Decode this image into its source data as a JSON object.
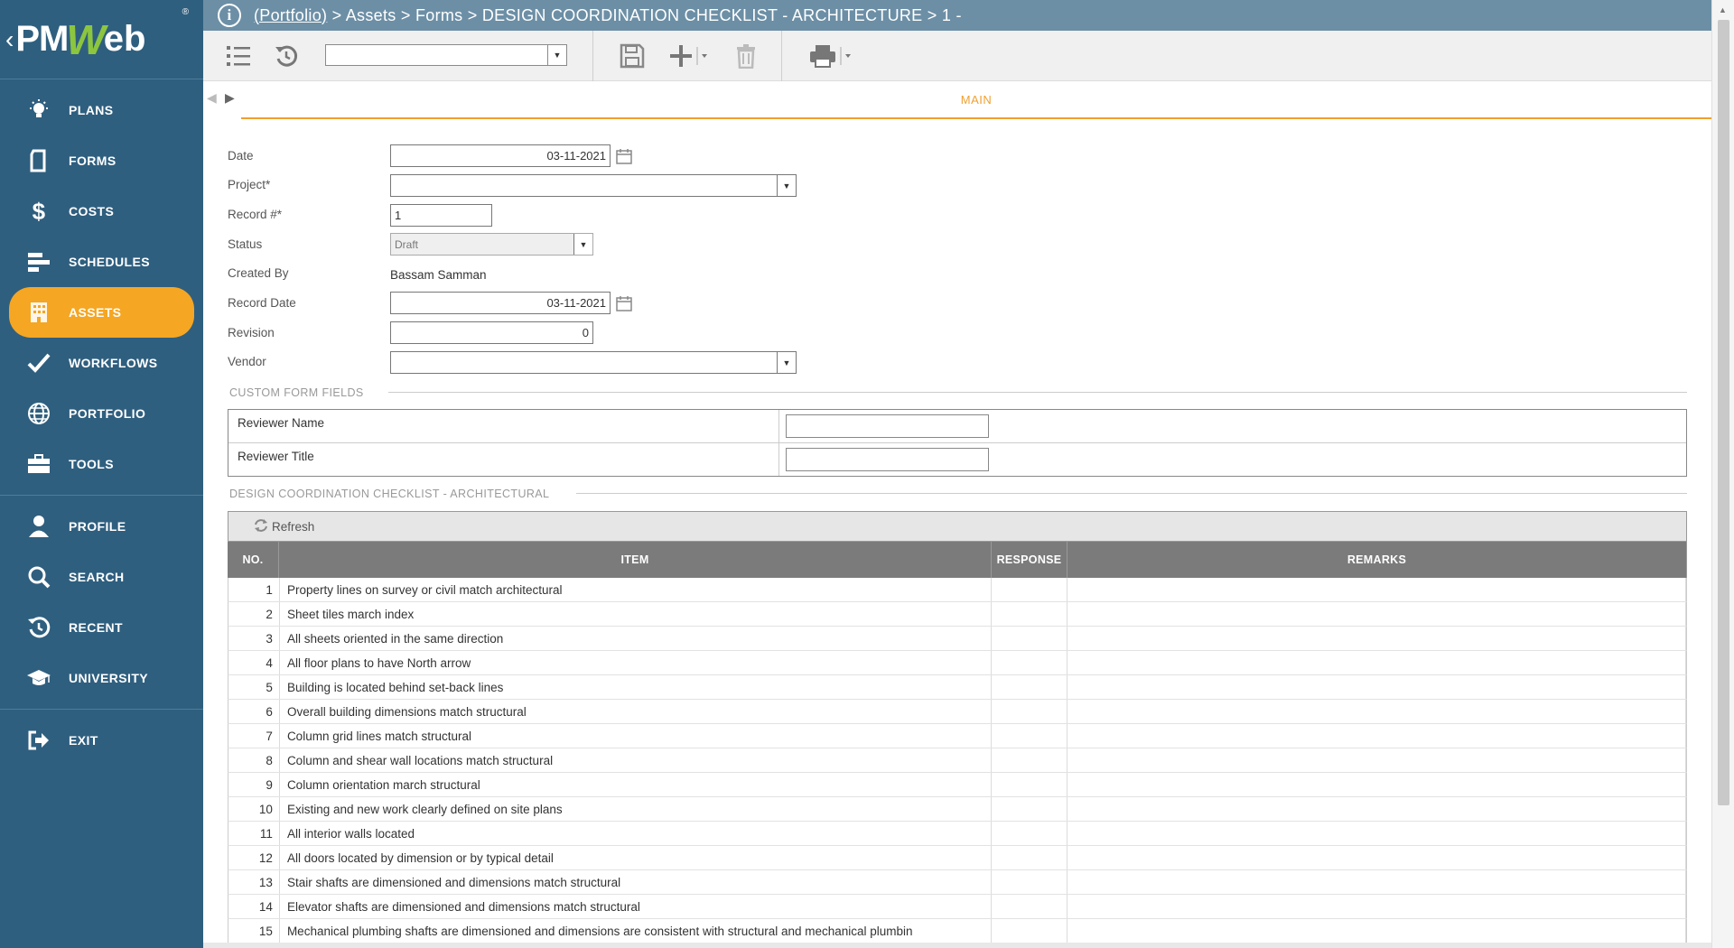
{
  "sidebar": {
    "logo": {
      "chevron": "‹",
      "pm": "PM",
      "w": "W",
      "eb": "eb",
      "reg": "®"
    },
    "groups": [
      [
        {
          "label": "PLANS",
          "icon": "lightbulb-icon"
        },
        {
          "label": "FORMS",
          "icon": "document-icon"
        },
        {
          "label": "COSTS",
          "icon": "dollar-icon"
        },
        {
          "label": "SCHEDULES",
          "icon": "gantt-icon"
        },
        {
          "label": "ASSETS",
          "icon": "building-icon",
          "active": true
        },
        {
          "label": "WORKFLOWS",
          "icon": "checkmark-icon"
        },
        {
          "label": "PORTFOLIO",
          "icon": "globe-icon"
        },
        {
          "label": "TOOLS",
          "icon": "briefcase-icon"
        }
      ],
      [
        {
          "label": "PROFILE",
          "icon": "user-icon"
        },
        {
          "label": "SEARCH",
          "icon": "search-icon"
        },
        {
          "label": "RECENT",
          "icon": "history-icon"
        },
        {
          "label": "UNIVERSITY",
          "icon": "graduation-cap-icon"
        }
      ],
      [
        {
          "label": "EXIT",
          "icon": "exit-icon"
        }
      ]
    ],
    "active_color": "#f5a623",
    "bg_color": "#2f5f7f"
  },
  "breadcrumb": {
    "info": "i",
    "portfolio_link": "(Portfolio)",
    "rest": " > Assets > Forms > DESIGN COORDINATION CHECKLIST - ARCHITECTURE > 1 -"
  },
  "toolbar": {
    "select_value": "",
    "icons": [
      "list-icon",
      "history-icon",
      "save-icon",
      "add-icon",
      "delete-icon",
      "print-icon"
    ]
  },
  "tabs": {
    "main": "MAIN"
  },
  "form": {
    "date_label": "Date",
    "date_value": "03-11-2021",
    "project_label": "Project*",
    "project_value": "",
    "record_no_label": "Record #*",
    "record_no_value": "1",
    "status_label": "Status",
    "status_value": "Draft",
    "created_by_label": "Created By",
    "created_by_value": "Bassam Samman",
    "record_date_label": "Record Date",
    "record_date_value": "03-11-2021",
    "revision_label": "Revision",
    "revision_value": "0",
    "vendor_label": "Vendor",
    "vendor_value": ""
  },
  "custom_fields": {
    "title": "CUSTOM FORM FIELDS",
    "reviewer_name_label": "Reviewer Name",
    "reviewer_name_value": "",
    "reviewer_title_label": "Reviewer Title",
    "reviewer_title_value": ""
  },
  "checklist": {
    "title": "DESIGN COORDINATION CHECKLIST - ARCHITECTURAL",
    "refresh_label": "Refresh",
    "columns": {
      "no": "NO.",
      "item": "ITEM",
      "response": "RESPONSE",
      "remarks": "REMARKS"
    },
    "rows": [
      {
        "no": "1",
        "item": "Property lines on survey or civil match architectural",
        "response": "",
        "remarks": ""
      },
      {
        "no": "2",
        "item": "Sheet tiles march index",
        "response": "",
        "remarks": ""
      },
      {
        "no": "3",
        "item": "All sheets oriented in the same direction",
        "response": "",
        "remarks": ""
      },
      {
        "no": "4",
        "item": "All floor plans to have North arrow",
        "response": "",
        "remarks": ""
      },
      {
        "no": "5",
        "item": "Building is located behind set-back lines",
        "response": "",
        "remarks": ""
      },
      {
        "no": "6",
        "item": "Overall building dimensions match structural",
        "response": "",
        "remarks": ""
      },
      {
        "no": "7",
        "item": "Column grid lines match structural",
        "response": "",
        "remarks": ""
      },
      {
        "no": "8",
        "item": "Column and shear wall locations match structural",
        "response": "",
        "remarks": ""
      },
      {
        "no": "9",
        "item": "Column orientation march structural",
        "response": "",
        "remarks": ""
      },
      {
        "no": "10",
        "item": "Existing and new work clearly defined on site plans",
        "response": "",
        "remarks": ""
      },
      {
        "no": "11",
        "item": "All interior walls located",
        "response": "",
        "remarks": ""
      },
      {
        "no": "12",
        "item": "All doors located by dimension or by typical detail",
        "response": "",
        "remarks": ""
      },
      {
        "no": "13",
        "item": "Stair shafts are dimensioned and dimensions match structural",
        "response": "",
        "remarks": ""
      },
      {
        "no": "14",
        "item": "Elevator shafts are dimensioned and dimensions match structural",
        "response": "",
        "remarks": ""
      },
      {
        "no": "15",
        "item": "Mechanical plumbing shafts are dimensioned and dimensions are consistent with structural and mechanical plumbin",
        "response": "",
        "remarks": ""
      }
    ]
  },
  "colors": {
    "topbar": "#6c8fa6",
    "tab_accent": "#f0a030",
    "grid_header": "#7b7b7b"
  }
}
